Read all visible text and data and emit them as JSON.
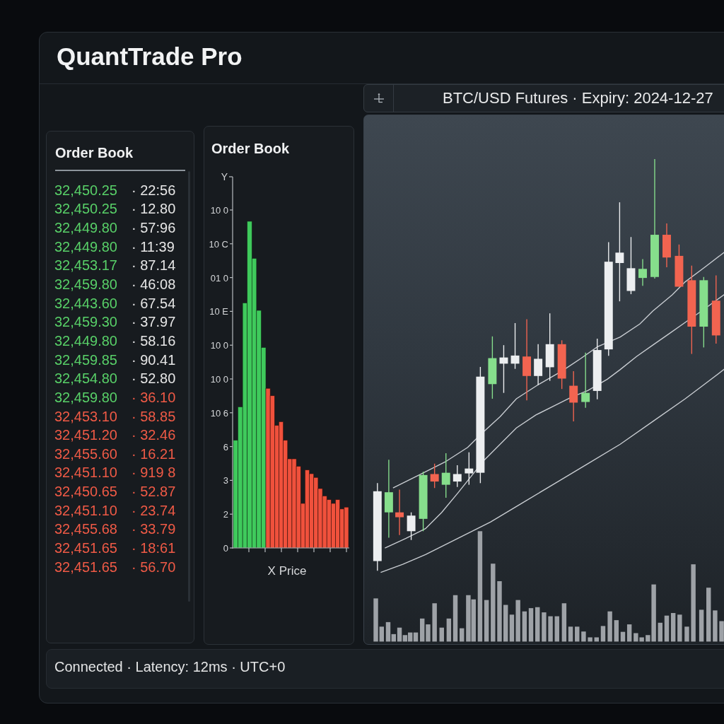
{
  "window": {
    "title": "QuantTrade Pro"
  },
  "order_book": {
    "title": "Order Book",
    "rows": [
      {
        "price": {
          "text": "32,450.25",
          "color": "#58d068"
        },
        "size": {
          "text": "· 22:56",
          "color": "#e6e6e6"
        }
      },
      {
        "price": {
          "text": "32,450.25",
          "color": "#58d068"
        },
        "size": {
          "text": "· 12.80",
          "color": "#e6e6e6"
        }
      },
      {
        "price": {
          "text": "32,449.80",
          "color": "#58d068"
        },
        "size": {
          "text": "· 57:96",
          "color": "#e6e6e6"
        }
      },
      {
        "price": {
          "text": "32,449.80",
          "color": "#58d068"
        },
        "size": {
          "text": "· 11:39",
          "color": "#e6e6e6"
        }
      },
      {
        "price": {
          "text": "32,453.17",
          "color": "#58d068"
        },
        "size": {
          "text": "· 87.14",
          "color": "#e6e6e6"
        }
      },
      {
        "price": {
          "text": "32,459.80",
          "color": "#58d068"
        },
        "size": {
          "text": "· 46:08",
          "color": "#e6e6e6"
        }
      },
      {
        "price": {
          "text": "32,443.60",
          "color": "#58d068"
        },
        "size": {
          "text": "· 67.54",
          "color": "#e6e6e6"
        }
      },
      {
        "price": {
          "text": "32,459.30",
          "color": "#58d068"
        },
        "size": {
          "text": "· 37.97",
          "color": "#e6e6e6"
        }
      },
      {
        "price": {
          "text": "32,449.80",
          "color": "#58d068"
        },
        "size": {
          "text": "· 58.16",
          "color": "#e6e6e6"
        }
      },
      {
        "price": {
          "text": "32,459.85",
          "color": "#58d068"
        },
        "size": {
          "text": "· 90.41",
          "color": "#e6e6e6"
        }
      },
      {
        "price": {
          "text": "32,454.80",
          "color": "#58d068"
        },
        "size": {
          "text": "· 52.80",
          "color": "#e6e6e6"
        }
      },
      {
        "price": {
          "text": "32,459.80",
          "color": "#58d068"
        },
        "size": {
          "text": "· 36.10",
          "color": "#f05a46"
        }
      },
      {
        "price": {
          "text": "32,453.10",
          "color": "#f05a46"
        },
        "size": {
          "text": "· 58.85",
          "color": "#f05a46"
        }
      },
      {
        "price": {
          "text": "32,451.20",
          "color": "#f05a46"
        },
        "size": {
          "text": "· 32.46",
          "color": "#f05a46"
        }
      },
      {
        "price": {
          "text": "32,455.60",
          "color": "#f05a46"
        },
        "size": {
          "text": "· 16.21",
          "color": "#f05a46"
        }
      },
      {
        "price": {
          "text": "32,451.10",
          "color": "#f05a46"
        },
        "size": {
          "text": "· 919 8",
          "color": "#f05a46"
        }
      },
      {
        "price": {
          "text": "32,450.65",
          "color": "#f05a46"
        },
        "size": {
          "text": "· 52.87",
          "color": "#f05a46"
        }
      },
      {
        "price": {
          "text": "32,451.10",
          "color": "#f05a46"
        },
        "size": {
          "text": "· 23.74",
          "color": "#f05a46"
        }
      },
      {
        "price": {
          "text": "32,455.68",
          "color": "#f05a46"
        },
        "size": {
          "text": "· 33.79",
          "color": "#f05a46"
        }
      },
      {
        "price": {
          "text": "32,451.65",
          "color": "#f05a46"
        },
        "size": {
          "text": "· 18:61",
          "color": "#f05a46"
        }
      },
      {
        "price": {
          "text": "32,451.65",
          "color": "#f05a46"
        },
        "size": {
          "text": "· 56.70",
          "color": "#f05a46"
        }
      }
    ]
  },
  "depth_chart": {
    "title": "Order Book",
    "y_axis_label": "Y",
    "y_ticks": [
      "10 0",
      "10 C",
      "01 0",
      "10 E",
      "10 0",
      "10 0",
      "10 6",
      "6",
      "3",
      "2",
      "0"
    ],
    "x_axis_label": "X Price"
  },
  "instrument_bar": {
    "label": "BTC/USD Futures · Expiry: 2024-12-27"
  },
  "status_bar": {
    "text": "Connected · Latency: 12ms · UTC+0"
  }
}
